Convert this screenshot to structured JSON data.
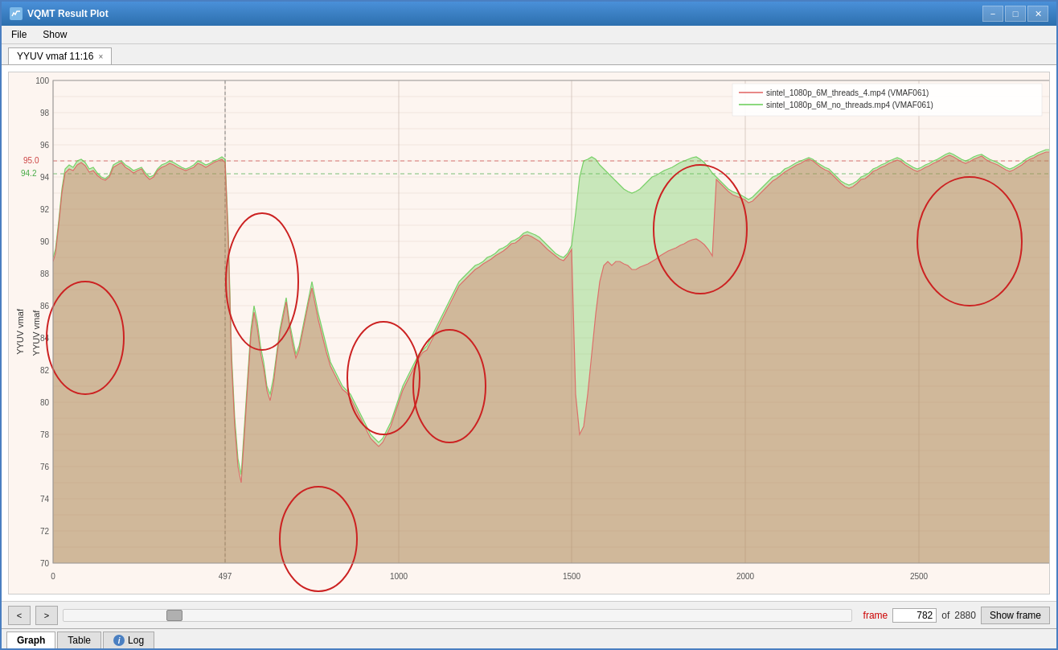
{
  "window": {
    "title": "VQMT Result Plot"
  },
  "titlebar": {
    "minimize_label": "−",
    "maximize_label": "□",
    "close_label": "✕"
  },
  "menubar": {
    "items": [
      "File",
      "Show"
    ]
  },
  "tab": {
    "label": "YYUV vmaf 11:16",
    "close": "×"
  },
  "chart": {
    "y_axis_label": "YYUV vmaf",
    "x_ticks": [
      "0",
      "497",
      "1000",
      "1500",
      "2000",
      "2500"
    ],
    "y_ticks": [
      "70",
      "72",
      "74",
      "76",
      "78",
      "80",
      "82",
      "84",
      "86",
      "88",
      "90",
      "92",
      "94",
      "96",
      "98",
      "100"
    ],
    "ref_line_95_label": "95.0",
    "ref_line_942_label": "94.2",
    "cursor_frame": "497"
  },
  "legend": {
    "items": [
      {
        "label": "sintel_1080p_6M_threads_4.mp4 (VMAF061)",
        "color": "#e88080"
      },
      {
        "label": "sintel_1080p_6M_no_threads.mp4 (VMAF061)",
        "color": "#66bb66"
      }
    ]
  },
  "bottom_bar": {
    "prev_label": "<",
    "next_label": ">",
    "frame_label": "frame",
    "frame_value": "782",
    "total_frames": "2880",
    "show_frame_label": "Show frame"
  },
  "bottom_tabs": [
    {
      "label": "Graph",
      "active": true
    },
    {
      "label": "Table",
      "active": false
    },
    {
      "label": "Log",
      "active": false,
      "info": true
    }
  ]
}
